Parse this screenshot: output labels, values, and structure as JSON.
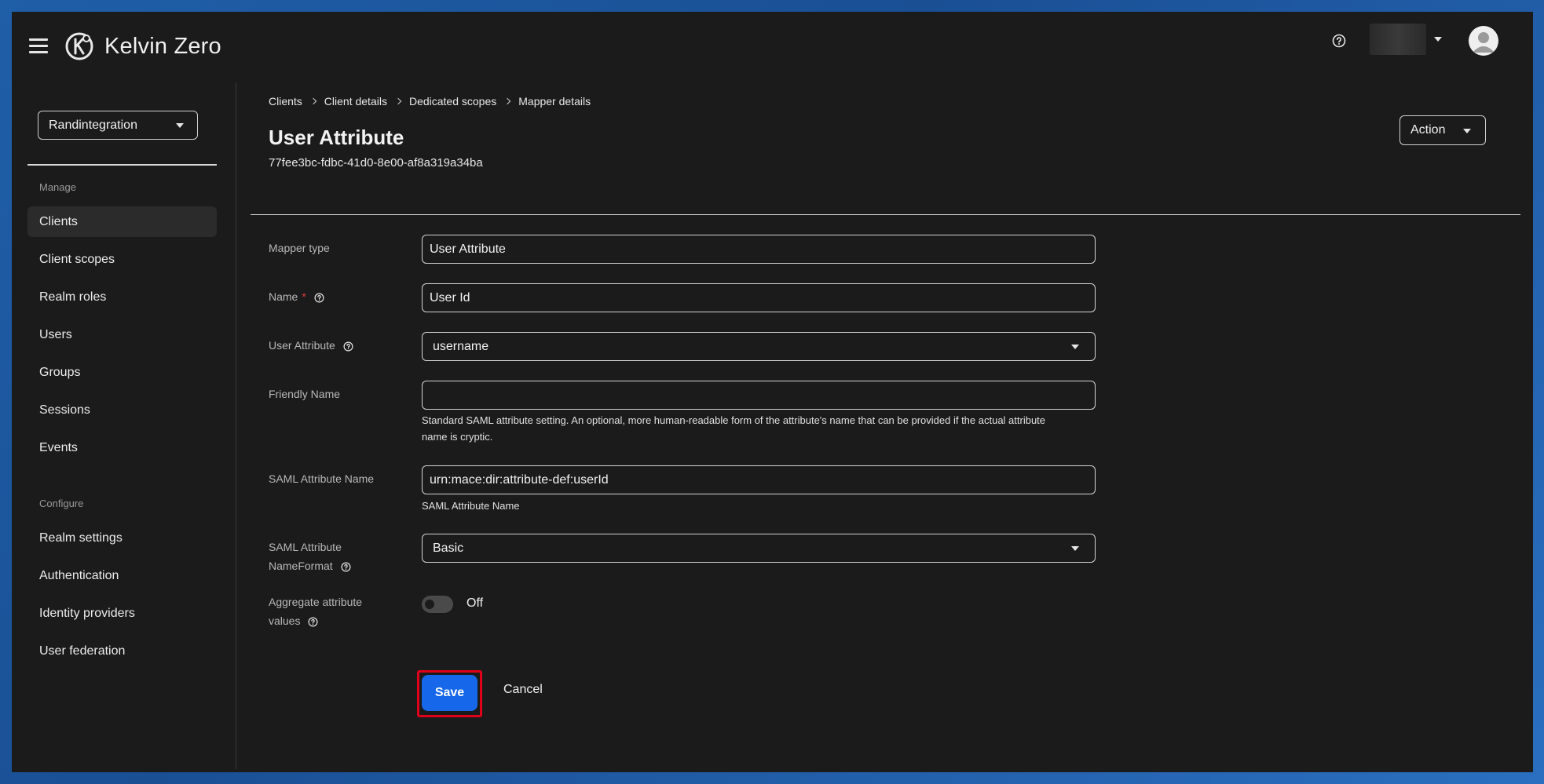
{
  "header": {
    "app_name": "Kelvin Zero",
    "icons": {
      "menu": "hamburger-icon",
      "logo": "kelvin-zero-logo",
      "help": "help-icon",
      "user_menu": "caret-down-icon",
      "avatar": "user-avatar-icon"
    }
  },
  "sidebar": {
    "realm": "Randintegration",
    "sections": [
      {
        "label": "Manage",
        "items": [
          {
            "label": "Clients",
            "active": true
          },
          {
            "label": "Client scopes"
          },
          {
            "label": "Realm roles"
          },
          {
            "label": "Users"
          },
          {
            "label": "Groups"
          },
          {
            "label": "Sessions"
          },
          {
            "label": "Events"
          }
        ]
      },
      {
        "label": "Configure",
        "items": [
          {
            "label": "Realm settings"
          },
          {
            "label": "Authentication"
          },
          {
            "label": "Identity providers"
          },
          {
            "label": "User federation"
          }
        ]
      }
    ]
  },
  "breadcrumb": [
    "Clients",
    "Client details",
    "Dedicated scopes",
    "Mapper details"
  ],
  "page": {
    "title": "User Attribute",
    "id": "77fee3bc-fdbc-41d0-8e00-af8a319a34ba",
    "action_label": "Action"
  },
  "form": {
    "mapper_type": {
      "label": "Mapper type",
      "value": "User Attribute"
    },
    "name": {
      "label": "Name",
      "required_mark": "*",
      "value": "User Id"
    },
    "user_attribute": {
      "label": "User Attribute",
      "value": "username"
    },
    "friendly_name": {
      "label": "Friendly Name",
      "value": "",
      "helper": "Standard SAML attribute setting. An optional, more human-readable form of the attribute's name that can be provided if the actual attribute name is cryptic."
    },
    "saml_attribute_name": {
      "label": "SAML Attribute Name",
      "value": "urn:mace:dir:attribute-def:userId",
      "helper": "SAML Attribute Name"
    },
    "saml_name_format": {
      "label_line1": "SAML Attribute",
      "label_line2": "NameFormat",
      "value": "Basic"
    },
    "aggregate": {
      "label_line1": "Aggregate attribute",
      "label_line2": "values",
      "state": "Off"
    }
  },
  "buttons": {
    "save": "Save",
    "cancel": "Cancel"
  },
  "colors": {
    "accent": "#1667ea",
    "highlight": "#e0001a",
    "required": "#e23b3b"
  }
}
